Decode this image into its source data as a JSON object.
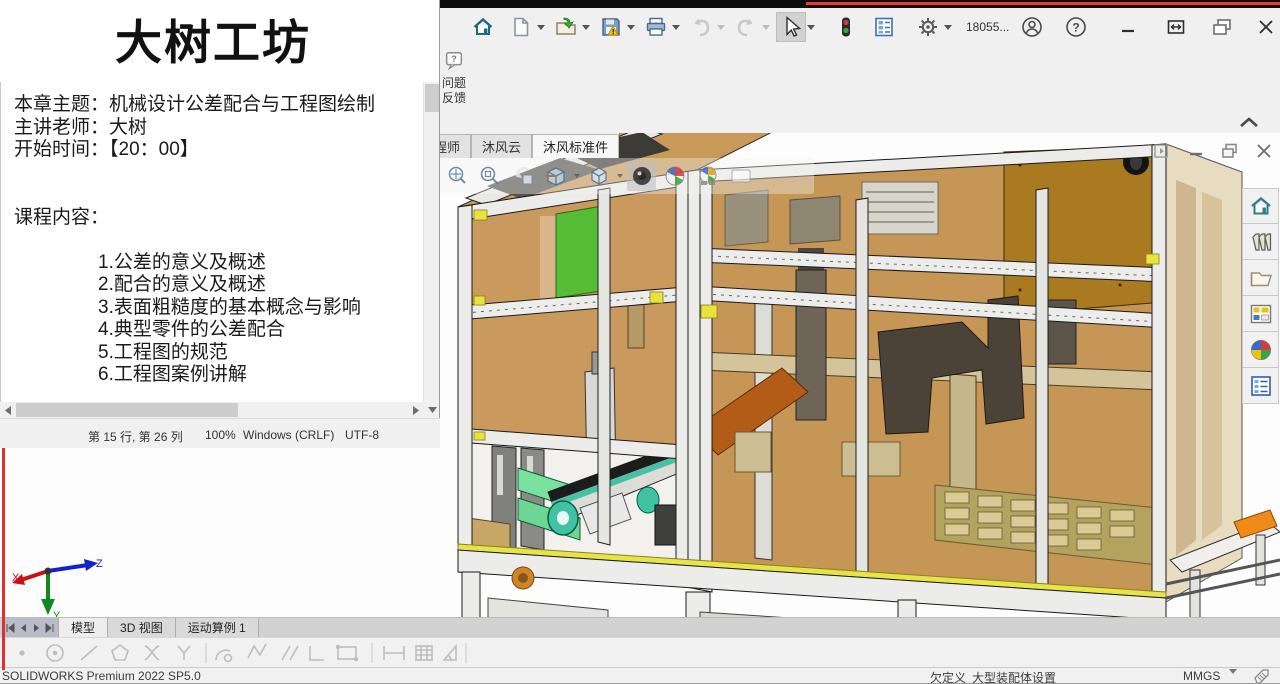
{
  "notepad": {
    "title": "大树工坊",
    "info_lines": [
      "本章主题：机械设计公差配合与工程图绘制",
      "主讲老师：大树",
      "开始时间：【20：00】"
    ],
    "section_label": "课程内容：",
    "course_items": [
      "1.公差的意义及概述",
      "2.配合的意义及概述",
      "3.表面粗糙度的基本概念与影响",
      "4.典型零件的公差配合",
      "5.工程图的规范",
      "6.工程图案例讲解"
    ],
    "status": {
      "cursor": "第 15 行, 第 26 列",
      "zoom": "100%",
      "eol": "Windows (CRLF)",
      "encoding": "UTF-8"
    }
  },
  "solidworks": {
    "quick_access_icons": [
      "home",
      "new-document",
      "open",
      "save",
      "print",
      "undo",
      "redo",
      "select-arrow",
      "traffic-light",
      "display-settings",
      "options-gear",
      "account",
      "help"
    ],
    "user_id": "18055...",
    "window_controls": [
      "minimize",
      "restore",
      "cascade",
      "close"
    ],
    "feedback_button": {
      "line1": "问题",
      "line2": "反馈"
    },
    "commandmanager_tabs": [
      "工程师",
      "沐风云",
      "沐风标准件"
    ],
    "active_commandmanager_tab": "沐风标准件",
    "headsup_icons": [
      "zoom-to-fit",
      "zoom-to-area",
      "previous-view",
      "section-view",
      "view-orientation",
      "hide-show-items",
      "edit-appearance",
      "apply-scene",
      "view-settings"
    ],
    "taskpane_icons": [
      "resources-home",
      "design-library",
      "file-explorer",
      "view-palette",
      "appearances-scenes",
      "custom-properties"
    ],
    "bottom_tabs": [
      "模型",
      "3D 视图",
      "运动算例 1"
    ],
    "active_bottom_tab": "模型",
    "status_bar": {
      "product": "SOLIDWORKS Premium 2022 SP5.0",
      "constraint": "欠定义",
      "assembly_mode": "大型装配体设置",
      "units": "MMGS"
    },
    "triad_labels": {
      "x": "X",
      "y": "Y",
      "z": "Z"
    }
  },
  "colors": {
    "accent_red": "#e03030",
    "panel_amber": "#c69050",
    "panel_amber_dark": "#aa7a21",
    "green_panel": "#56bb35",
    "mint_block": "#74e39b",
    "teal_roller": "#49c6a8",
    "yellow_strip": "#e6e44a",
    "frame_white": "#ececea"
  }
}
